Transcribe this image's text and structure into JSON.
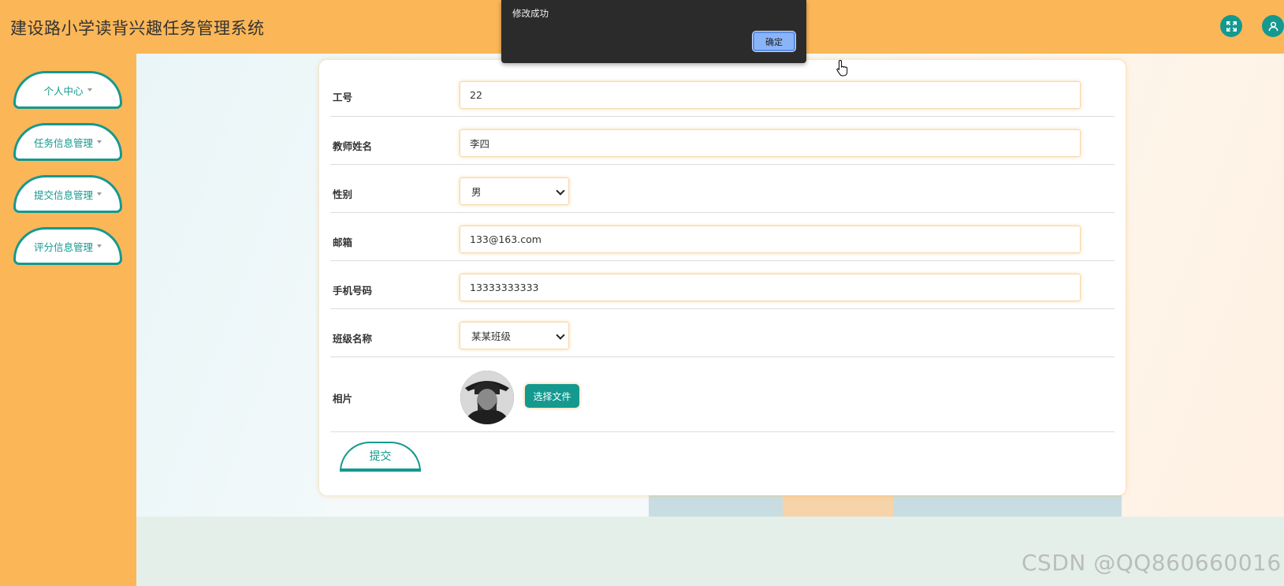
{
  "header": {
    "title": "建设路小学读背兴趣任务管理系统",
    "fullscreen_icon": "fullscreen-icon",
    "user_icon": "user-icon"
  },
  "sidebar": {
    "items": [
      {
        "label": "个人中心"
      },
      {
        "label": "任务信息管理"
      },
      {
        "label": "提交信息管理"
      },
      {
        "label": "评分信息管理"
      }
    ]
  },
  "form": {
    "fields": [
      {
        "label": "工号",
        "value": "22"
      },
      {
        "label": "教师姓名",
        "value": "李四"
      },
      {
        "label": "性别",
        "value": "男"
      },
      {
        "label": "邮箱",
        "value": "133@163.com"
      },
      {
        "label": "手机号码",
        "value": "13333333333"
      },
      {
        "label": "班级名称",
        "value": "某某班级"
      },
      {
        "label": "相片"
      }
    ],
    "file_button": "选择文件",
    "submit_label": "提交"
  },
  "dialog": {
    "message": "修改成功",
    "ok_label": "确定"
  },
  "watermark": "CSDN @QQ860660016",
  "colors": {
    "brand_orange": "#fbb657",
    "accent_teal": "#14998f"
  }
}
